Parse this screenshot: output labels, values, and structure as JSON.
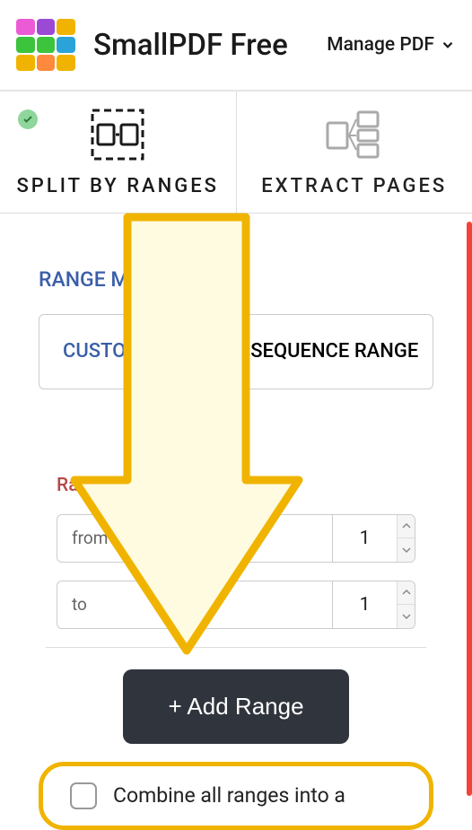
{
  "header": {
    "app_title": "SmallPDF Free",
    "manage_pdf": "Manage PDF"
  },
  "logo_colors": [
    "#eb5bd6",
    "#9b4ad6",
    "#f0b400",
    "#3cc43c",
    "#3cc43c",
    "#2aa3d9",
    "#f0b400",
    "#ff8a3d",
    "#f0b400"
  ],
  "mode_tabs": {
    "split": "SPLIT BY RANGES",
    "extract": "EXTRACT PAGES"
  },
  "range_mode_label": "RANGE MODE",
  "range_type": {
    "custom": "CUSTOM RANGE",
    "sequence": "SEQUENCE RANGE"
  },
  "range_block": {
    "label": "Range 1",
    "from_label": "from",
    "from_value": "1",
    "to_label": "to",
    "to_value": "1"
  },
  "add_range_button": "+ Add Range",
  "combine": {
    "label": "Combine all ranges into a"
  },
  "accent_color": "#f0b400",
  "primary_color": "#3a5fa8"
}
